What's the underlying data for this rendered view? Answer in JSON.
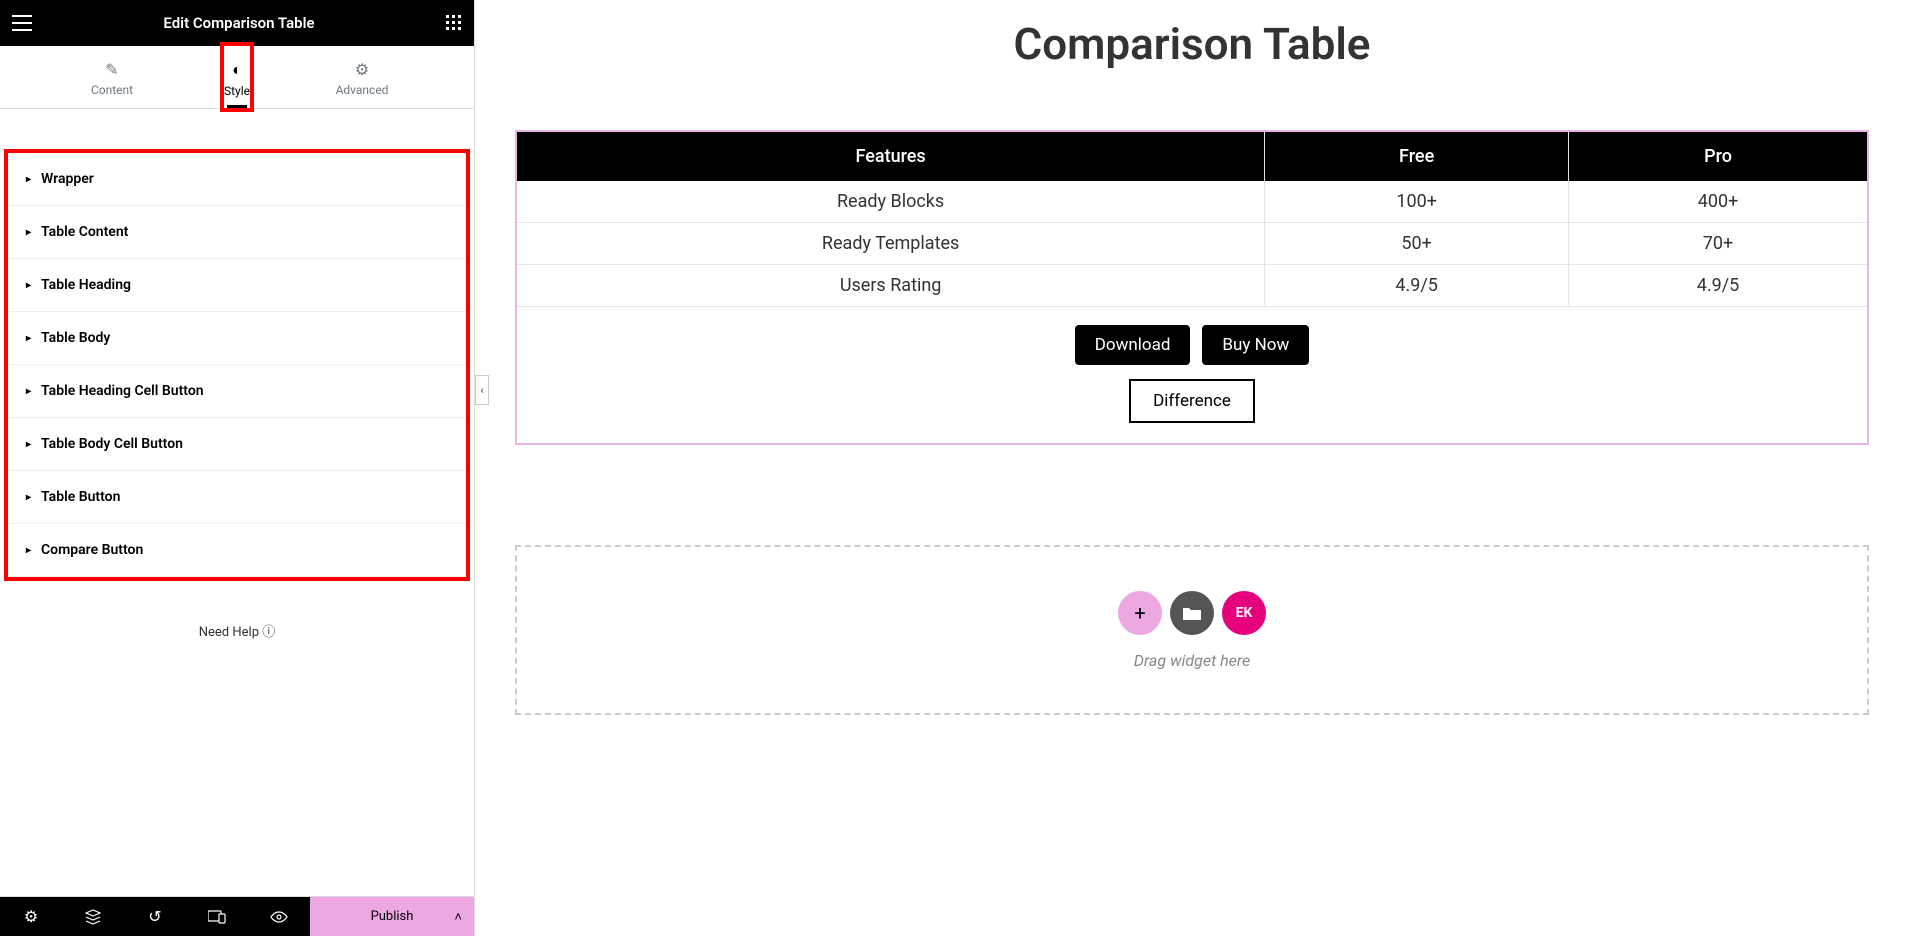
{
  "header": {
    "title": "Edit Comparison Table"
  },
  "tabs": {
    "content": "Content",
    "style": "Style",
    "advanced": "Advanced"
  },
  "accordion": [
    "Wrapper",
    "Table Content",
    "Table Heading",
    "Table Body",
    "Table Heading Cell Button",
    "Table Body Cell Button",
    "Table Button",
    "Compare Button"
  ],
  "help": "Need Help",
  "publish": "Publish",
  "page": {
    "title": "Comparison Table"
  },
  "table": {
    "headers": [
      "Features",
      "Free",
      "Pro"
    ],
    "rows": [
      [
        "Ready Blocks",
        "100+",
        "400+"
      ],
      [
        "Ready Templates",
        "50+",
        "70+"
      ],
      [
        "Users Rating",
        "4.9/5",
        "4.9/5"
      ]
    ],
    "buttons": {
      "download": "Download",
      "buy": "Buy Now",
      "diff": "Difference"
    }
  },
  "drop": {
    "text": "Drag widget here",
    "ek": "EK"
  }
}
